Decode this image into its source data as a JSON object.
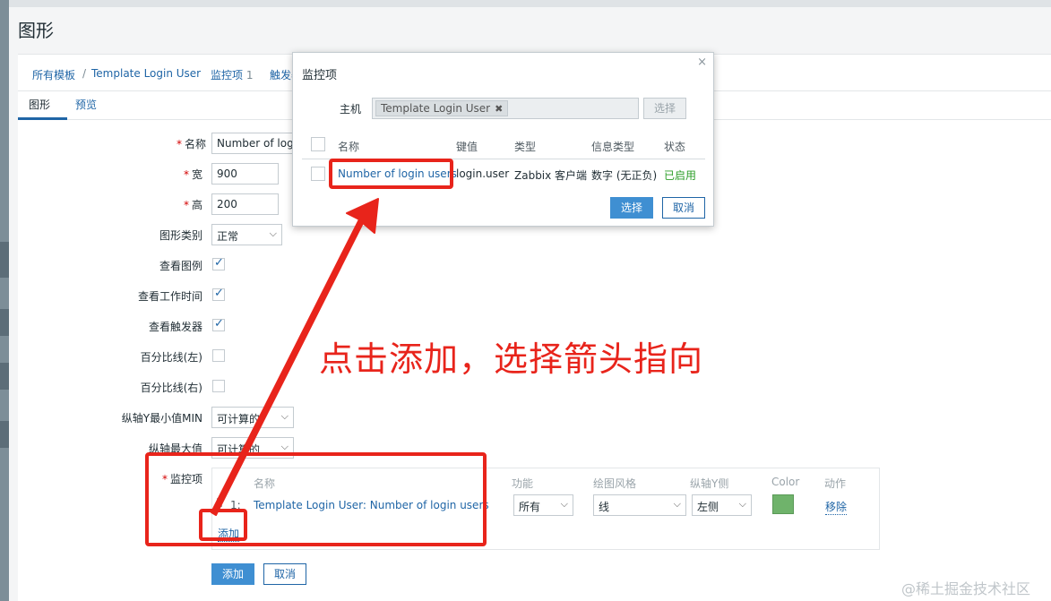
{
  "page": {
    "title": "图形"
  },
  "breadcrumb": {
    "items": [
      {
        "label": "所有模板"
      },
      {
        "label": "Template Login User"
      },
      {
        "label": "监控项",
        "count": "1"
      },
      {
        "label": "触发器"
      }
    ],
    "separator": "/"
  },
  "tabs": [
    {
      "label": "图形"
    },
    {
      "label": "预览"
    }
  ],
  "form": {
    "name": {
      "label": "名称",
      "value": "Number of login u"
    },
    "width": {
      "label": "宽",
      "value": "900"
    },
    "height": {
      "label": "高",
      "value": "200"
    },
    "graph_type": {
      "label": "图形类别",
      "value": "正常"
    },
    "show_legend": {
      "label": "查看图例",
      "checked": true
    },
    "show_working_time": {
      "label": "查看工作时间",
      "checked": true
    },
    "show_triggers": {
      "label": "查看触发器",
      "checked": true
    },
    "percentile_left": {
      "label": "百分比线(左)",
      "checked": false
    },
    "percentile_right": {
      "label": "百分比线(右)",
      "checked": false
    },
    "y_min": {
      "label": "纵轴Y最小值MIN",
      "value": "可计算的"
    },
    "y_max": {
      "label": "纵轴最大值",
      "value": "可计算的"
    },
    "items_label": "监控项",
    "items_table": {
      "headers": {
        "name": "名称",
        "function": "功能",
        "draw_style": "绘图风格",
        "y_axis": "纵轴Y侧",
        "color": "Color",
        "action": "动作"
      },
      "rows": [
        {
          "index": "1:",
          "name": "Template Login User: Number of login users",
          "function": "所有",
          "draw_style": "线",
          "y_axis": "左侧",
          "color": "#6fb36b",
          "action": "移除"
        }
      ],
      "add_link": "添加"
    },
    "submit_label": "添加",
    "cancel_label": "取消"
  },
  "modal": {
    "title": "监控项",
    "close": "×",
    "host_label": "主机",
    "host_chip": "Template Login User",
    "host_chip_remove": "✖",
    "host_select": "选择",
    "columns": {
      "name": "名称",
      "key": "键值",
      "type": "类型",
      "info_type": "信息类型",
      "status": "状态"
    },
    "rows": [
      {
        "name": "Number of login users",
        "key": "login.user",
        "type": "Zabbix 客户端",
        "info_type": "数字 (无正负)",
        "status": "已启用"
      }
    ],
    "select_label": "选择",
    "cancel_label": "取消"
  },
  "annotation": {
    "text": "点击添加，选择箭头指向",
    "color": "#e8241b"
  },
  "watermark": "@稀土掘金技术社区"
}
